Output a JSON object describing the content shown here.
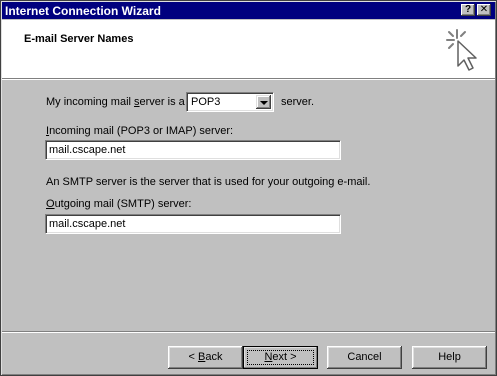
{
  "window": {
    "title": "Internet Connection Wizard",
    "help_label": "?",
    "close_label": "✕"
  },
  "header": {
    "title": "E-mail Server Names"
  },
  "form": {
    "incoming_type_prefix": "My incoming mail ",
    "incoming_type_underlined": "s",
    "incoming_type_suffix": "erver is a",
    "incoming_type_value": "POP3",
    "incoming_type_after": "server.",
    "incoming_label_underlined": "I",
    "incoming_label_rest": "ncoming mail (POP3 or IMAP) server:",
    "incoming_value": "mail.cscape.net",
    "smtp_info": "An SMTP server is the server that is used for your outgoing e-mail.",
    "outgoing_label_underlined": "O",
    "outgoing_label_rest": "utgoing mail (SMTP) server:",
    "outgoing_value": "mail.cscape.net"
  },
  "buttons": {
    "back_pre": "< ",
    "back_underlined": "B",
    "back_rest": "ack",
    "next_underlined": "N",
    "next_rest": "ext >",
    "cancel": "Cancel",
    "help": "Help"
  },
  "icons": {
    "header_icon": "wizard-cursor-icon",
    "dropdown_icon": "chevron-down-icon"
  }
}
